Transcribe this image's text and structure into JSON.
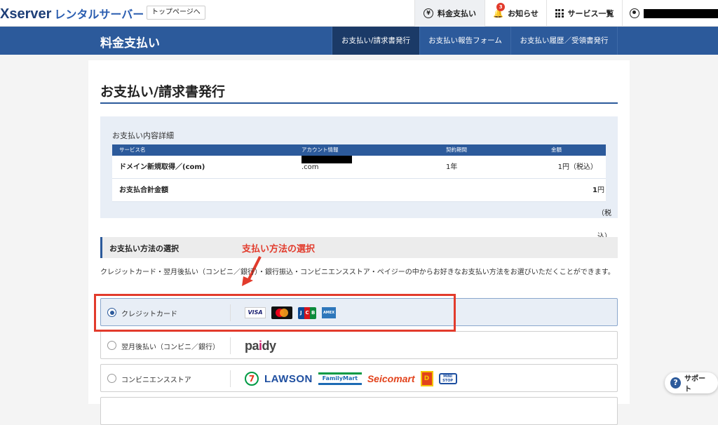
{
  "header": {
    "logo_brand": "Xserver",
    "logo_sub": "レンタルサーバー",
    "top_page_label": "トップページへ",
    "nav": {
      "fee_label": "料金支払い",
      "fee_icon": "yen-icon",
      "news_label": "お知らせ",
      "news_badge": "3",
      "services_label": "サービス一覧",
      "user_icon": "user-icon"
    }
  },
  "section": {
    "title": "料金支払い",
    "tabs": [
      {
        "label": "お支払い/請求書発行",
        "active": true
      },
      {
        "label": "お支払い報告フォーム",
        "active": false
      },
      {
        "label": "お支払い履歴／受領書発行",
        "active": false
      }
    ]
  },
  "page": {
    "title": "お支払い/請求書発行"
  },
  "details": {
    "heading": "お支払い内容詳細",
    "columns": [
      "サービス名",
      "アカウント情報",
      "契約期間",
      "金額"
    ],
    "row": {
      "service": "ドメイン新規取得／(com)",
      "account_suffix": ".com",
      "period": "1年",
      "amount": "1円（税込）"
    },
    "total_label": "お支払合計金額",
    "total_amount_number": "1",
    "total_amount_unit": "円（税込）"
  },
  "payment_method": {
    "heading": "お支払い方法の選択",
    "annotation": "支払い方法の選択",
    "description": "クレジットカード・翌月後払い（コンビニ／銀行）・銀行振込・コンビニエンスストア・ペイジーの中からお好きなお支払い方法をお選びいただくことができます。",
    "options": [
      {
        "label": "クレジットカード",
        "selected": true
      },
      {
        "label": "翌月後払い（コンビニ／銀行）",
        "selected": false
      },
      {
        "label": "コンビニエンスストア",
        "selected": false
      }
    ],
    "card_logos": {
      "visa": "VISA",
      "jcb": [
        "J",
        "C",
        "B"
      ],
      "amex": "AMEX"
    },
    "paidy": {
      "pre": "pa",
      "accent": "i",
      "post": "dy"
    },
    "cvs_logos": {
      "seven": "7",
      "lawson": "LAWSON",
      "familymart": "FamilyMart",
      "seicomart": "Seicomart",
      "daily": "D",
      "ministop": "MINI STOP"
    }
  },
  "support": {
    "label": "サポート",
    "icon": "?"
  },
  "colors": {
    "primary": "#2c5a9b",
    "accent_red": "#e23b2c"
  }
}
